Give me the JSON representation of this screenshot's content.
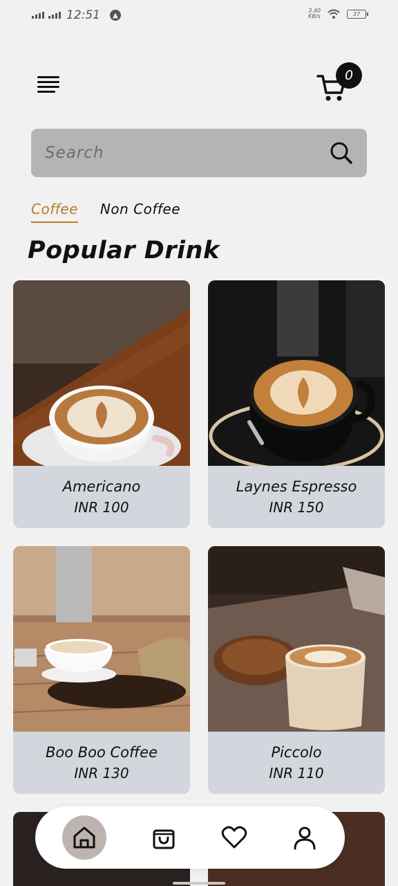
{
  "status_bar": {
    "time": "12:51",
    "net_speed_value": "3.40",
    "net_speed_unit": "KB/s",
    "battery": "37"
  },
  "header": {
    "menu_icon": "hamburger-menu-icon",
    "cart_icon": "cart-icon",
    "cart_count": "0"
  },
  "search": {
    "placeholder": "Search",
    "value": "",
    "icon": "search-icon"
  },
  "tabs": [
    {
      "label": "Coffee",
      "active": true
    },
    {
      "label": "Non Coffee",
      "active": false
    }
  ],
  "section_title": "Popular Drink",
  "products": [
    {
      "name": "Americano",
      "price": "INR 100"
    },
    {
      "name": "Laynes Espresso",
      "price": "INR 150"
    },
    {
      "name": "Boo Boo Coffee",
      "price": "INR 130"
    },
    {
      "name": "Piccolo",
      "price": "INR 110"
    }
  ],
  "bottom_nav": [
    {
      "icon": "home-icon",
      "active": true
    },
    {
      "icon": "shopping-bag-icon",
      "active": false
    },
    {
      "icon": "heart-icon",
      "active": false
    },
    {
      "icon": "profile-icon",
      "active": false
    }
  ],
  "colors": {
    "accent": "#b57b2e",
    "background": "#f1f1f1",
    "search_bg": "#b4b4b4",
    "card_info_bg": "#d4d6dd",
    "active_nav_bg": "#bdb4b0"
  }
}
